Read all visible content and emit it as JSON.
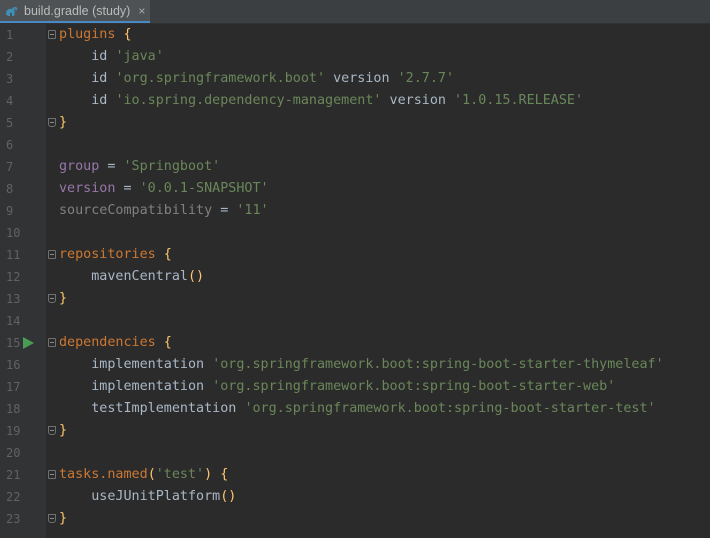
{
  "tab": {
    "title": "build.gradle (study)",
    "close": "×"
  },
  "lines": [
    {
      "n": "1"
    },
    {
      "n": "2"
    },
    {
      "n": "3"
    },
    {
      "n": "4"
    },
    {
      "n": "5"
    },
    {
      "n": "6"
    },
    {
      "n": "7"
    },
    {
      "n": "8"
    },
    {
      "n": "9"
    },
    {
      "n": "10"
    },
    {
      "n": "11"
    },
    {
      "n": "12"
    },
    {
      "n": "13"
    },
    {
      "n": "14"
    },
    {
      "n": "15"
    },
    {
      "n": "16"
    },
    {
      "n": "17"
    },
    {
      "n": "18"
    },
    {
      "n": "19"
    },
    {
      "n": "20"
    },
    {
      "n": "21"
    },
    {
      "n": "22"
    },
    {
      "n": "23"
    }
  ],
  "code": {
    "l1": {
      "a": "plugins",
      "b": " {"
    },
    "l2": {
      "a": "    id ",
      "b": "'java'"
    },
    "l3": {
      "a": "    id ",
      "b": "'org.springframework.boot'",
      "c": " version ",
      "d": "'2.7.7'"
    },
    "l4": {
      "a": "    id ",
      "b": "'io.spring.dependency-management'",
      "c": " version ",
      "d": "'1.0.15.RELEASE'"
    },
    "l5": {
      "a": "}"
    },
    "l7": {
      "a": "group",
      "b": " = ",
      "c": "'Springboot'"
    },
    "l8": {
      "a": "version",
      "b": " = ",
      "c": "'0.0.1-SNAPSHOT'"
    },
    "l9": {
      "a": "sourceCompatibility",
      "b": " = ",
      "c": "'11'"
    },
    "l11": {
      "a": "repositories",
      "b": " {"
    },
    "l12": {
      "a": "    mavenCentral",
      "b": "()"
    },
    "l13": {
      "a": "}"
    },
    "l15": {
      "a": "dependencies",
      "b": " {"
    },
    "l16": {
      "a": "    implementation ",
      "b": "'org.springframework.boot:spring-boot-starter-thymeleaf'"
    },
    "l17": {
      "a": "    implementation ",
      "b": "'org.springframework.boot:spring-boot-starter-web'"
    },
    "l18": {
      "a": "    testImplementation ",
      "b": "'org.springframework.boot:spring-boot-starter-test'"
    },
    "l19": {
      "a": "}"
    },
    "l21": {
      "a": "tasks.named",
      "b": "(",
      "c": "'test'",
      "d": ")",
      "e": " {"
    },
    "l22": {
      "a": "    useJUnitPlatform",
      "b": "()"
    },
    "l23": {
      "a": "}"
    }
  },
  "icons": {
    "tab_icon": "gradle-icon",
    "run": "run-gutter-icon"
  },
  "colors": {
    "background": "#2b2b2b",
    "keyword": "#cc7832",
    "string": "#6a8759",
    "brace": "#ffc66d",
    "property": "#9876aa",
    "gutter_run": "#499c54"
  }
}
